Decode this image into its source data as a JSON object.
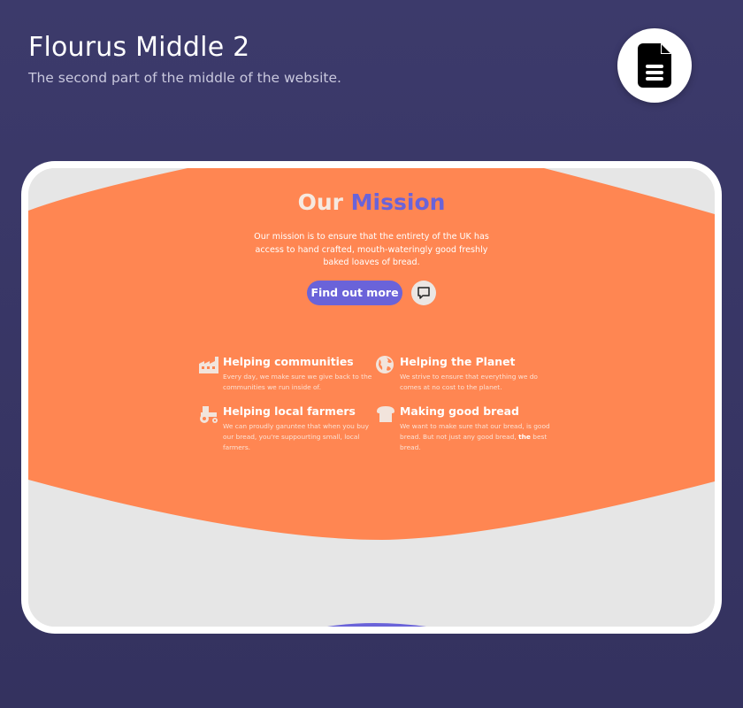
{
  "header": {
    "title": "Flourus Middle 2",
    "subtitle": "The second part of the middle of the website."
  },
  "doc_button": {
    "icon": "document-icon"
  },
  "mission": {
    "title_part1": "Our",
    "title_part2": "Mission",
    "text": "Our mission is to ensure that the entirety of the UK has access to hand crafted, mouth-wateringly good freshly baked loaves of bread.",
    "cta_label": "Find out more",
    "chat_icon": "chat-icon"
  },
  "features": [
    {
      "icon": "factory-icon",
      "title": "Helping communities",
      "desc": "Every day, we make sure we give back to the communities we run inside of."
    },
    {
      "icon": "globe-icon",
      "title": "Helping the Planet",
      "desc": "We strive to ensure that everything we do comes at no cost to the planet."
    },
    {
      "icon": "tractor-icon",
      "title": "Helping local farmers",
      "desc": "We can proudly garuntee that when you buy our bread, you're suppourting small, local farmers."
    },
    {
      "icon": "bread-icon",
      "title": "Making good bread",
      "desc_before": "We want to make sure that our bread, is good bread. But not just any good bread,",
      "desc_bold": "the",
      "desc_after": "best bread."
    }
  ],
  "colors": {
    "background": "#3c3a6b",
    "accent_orange": "#ff8652",
    "accent_purple": "#6a63d9",
    "screen_grey": "#e6e6e6"
  }
}
